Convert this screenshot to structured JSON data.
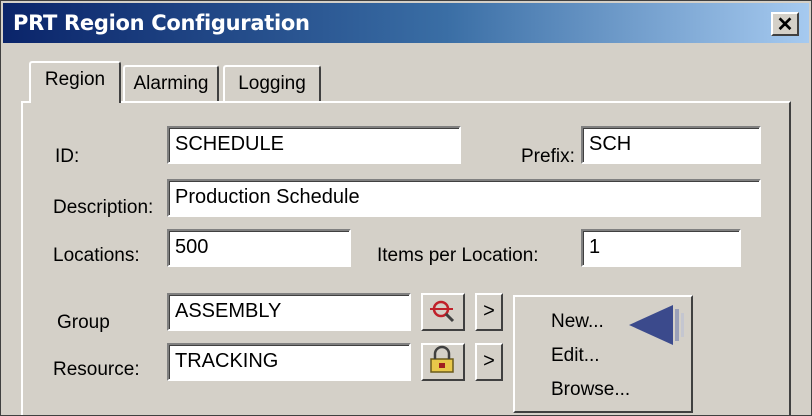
{
  "window": {
    "title": "PRT Region Configuration",
    "close_glyph": "✕"
  },
  "tabs": [
    {
      "label": "Region",
      "active": true
    },
    {
      "label": "Alarming",
      "active": false
    },
    {
      "label": "Logging",
      "active": false
    }
  ],
  "form": {
    "id_label": "ID:",
    "id_value": "SCHEDULE",
    "prefix_label": "Prefix:",
    "prefix_value": "SCH",
    "description_label": "Description:",
    "description_value": "Production Schedule",
    "locations_label": "Locations:",
    "locations_value": "500",
    "items_per_location_label": "Items per Location:",
    "items_per_location_value": "1",
    "group_label": "Group",
    "group_value": "ASSEMBLY",
    "resource_label": "Resource:",
    "resource_value": "TRACKING",
    "arrow_glyph": ">"
  },
  "icons": {
    "group_icon": "search-target-icon",
    "resource_icon": "lock-folder-icon",
    "pointer": "left-arrow-pointer-icon"
  },
  "menu": {
    "items": [
      {
        "label": "New..."
      },
      {
        "label": "Edit..."
      },
      {
        "label": "Browse..."
      }
    ]
  },
  "colors": {
    "title_start": "#0a246a",
    "title_end": "#a6caf0",
    "pointer": "#3b4a8c",
    "dialog_bg": "#d4d0c8"
  }
}
